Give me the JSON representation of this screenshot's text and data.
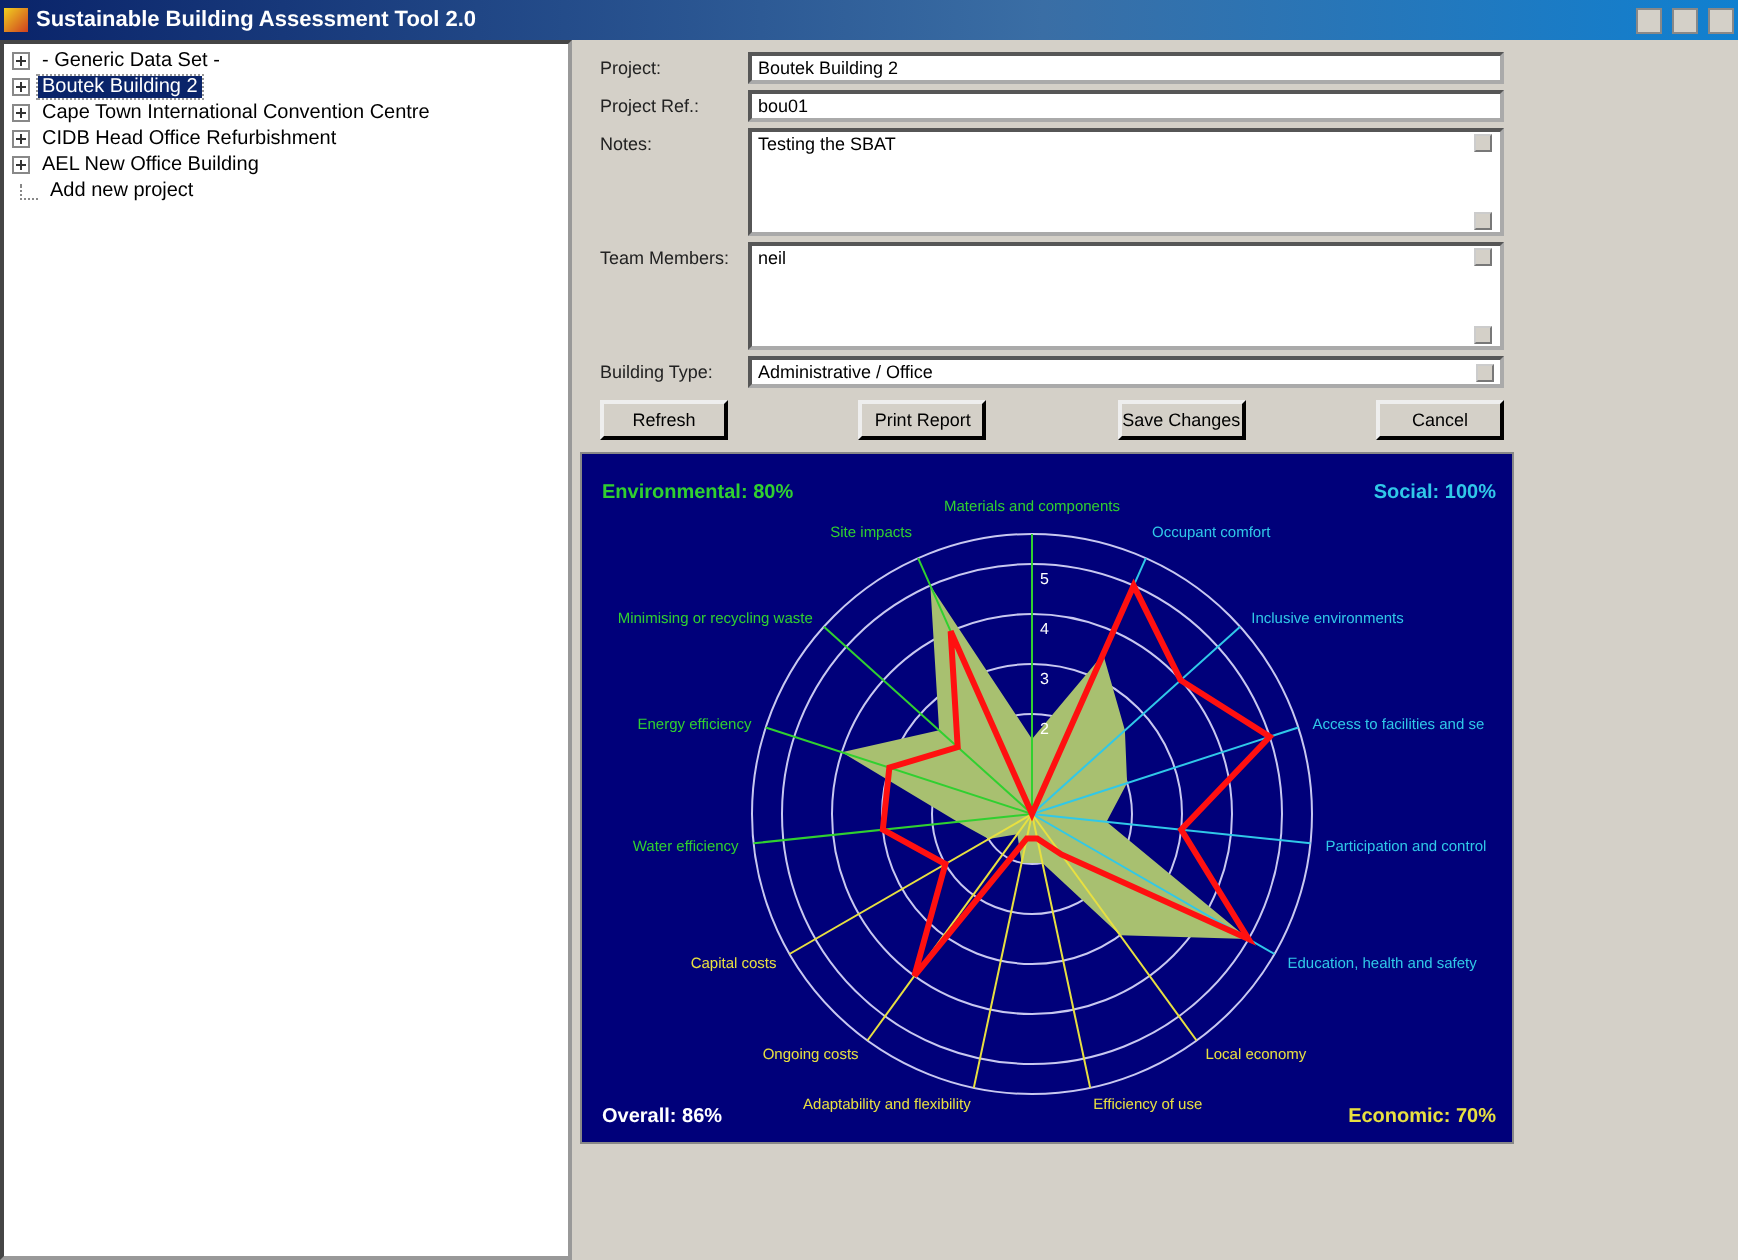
{
  "window": {
    "title": "Sustainable Building Assessment Tool 2.0"
  },
  "tree": {
    "items": [
      {
        "label": "- Generic Data Set -",
        "kind": "node",
        "expanded": false,
        "selected": false
      },
      {
        "label": "Boutek Building 2",
        "kind": "node",
        "expanded": false,
        "selected": true
      },
      {
        "label": "Cape Town International Convention Centre",
        "kind": "node",
        "expanded": false,
        "selected": false
      },
      {
        "label": "CIDB Head Office Refurbishment",
        "kind": "node",
        "expanded": false,
        "selected": false
      },
      {
        "label": "AEL New Office Building",
        "kind": "node",
        "expanded": false,
        "selected": false
      },
      {
        "label": "Add new project",
        "kind": "action",
        "selected": false
      }
    ]
  },
  "form": {
    "fields": [
      {
        "label": "Project:",
        "value": "Boutek Building 2",
        "kind": "text"
      },
      {
        "label": "Project Ref.:",
        "value": "bou01",
        "kind": "text"
      },
      {
        "label": "Notes:",
        "value": "Testing the SBAT",
        "kind": "memo"
      },
      {
        "label": "Team Members:",
        "value": "neil",
        "kind": "memo"
      },
      {
        "label": "Building Type:",
        "value": "Administrative / Office",
        "kind": "combo"
      }
    ],
    "buttons": [
      "Refresh",
      "Print Report",
      "Save Changes",
      "Cancel"
    ]
  },
  "radar": {
    "groups": [
      {
        "score": "Environmental: 80%",
        "color": "#30d030",
        "axes": [
          "Materials and components",
          "Site impacts",
          "Minimising or recycling waste",
          "Energy efficiency",
          "Water efficiency"
        ]
      },
      {
        "score": "Social: 100%",
        "color": "#30c8e8",
        "axes": [
          "Occupant comfort",
          "Inclusive environments",
          "Access to facilities and se",
          "Participation and control",
          "Education, health and safety"
        ]
      },
      {
        "score": "Overall: 86%",
        "color": "#ffffff"
      },
      {
        "score": "Economic: 70%",
        "color": "#e8e040",
        "axes": [
          "Capital costs",
          "Ongoing costs",
          "Adaptability and flexibility",
          "Efficiency of use",
          "Local economy"
        ]
      }
    ],
    "ticks": [
      "5",
      "4",
      "3",
      "2"
    ]
  }
}
